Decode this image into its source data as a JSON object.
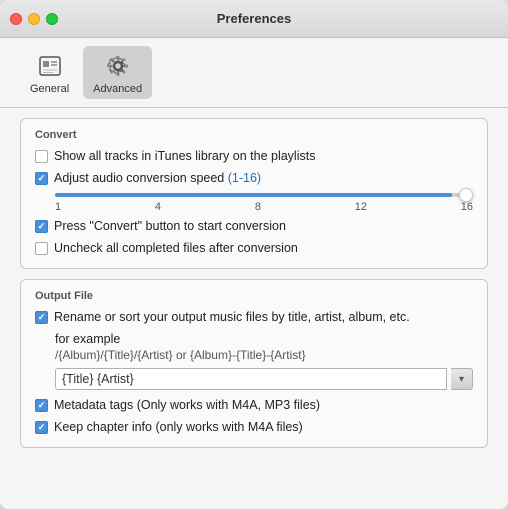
{
  "window": {
    "title": "Preferences"
  },
  "toolbar": {
    "items": [
      {
        "id": "general",
        "label": "General",
        "icon": "general",
        "active": false
      },
      {
        "id": "advanced",
        "label": "Advanced",
        "icon": "gear",
        "active": true
      }
    ]
  },
  "convert_section": {
    "title": "Convert",
    "checkboxes": [
      {
        "id": "show-all-tracks",
        "checked": false,
        "label": "Show all tracks in iTunes library on the playlists"
      },
      {
        "id": "adjust-audio",
        "checked": true,
        "label_prefix": "Adjust audio conversion speed ",
        "label_highlight": "(1-16)",
        "has_slider": true
      },
      {
        "id": "press-convert",
        "checked": true,
        "label": "Press \"Convert\" button to start conversion"
      },
      {
        "id": "uncheck-completed",
        "checked": false,
        "label": "Uncheck all completed files after conversion"
      }
    ],
    "slider": {
      "min_label": "1",
      "labels": [
        "1",
        "4",
        "8",
        "12",
        "16"
      ],
      "value": 95,
      "fill_percent": 95
    }
  },
  "output_section": {
    "title": "Output File",
    "rename_checkbox": {
      "checked": true,
      "label": "Rename or sort your output music files by title, artist, album, etc."
    },
    "for_example_label": "for example",
    "example_path": "/{Album}/{Title}/{Artist} or {Album}-{Title}-{Artist}",
    "input_value": "{Title} {Artist}",
    "input_placeholder": "{Title} {Artist}",
    "dropdown_icon": "▾",
    "metadata_checkbox": {
      "checked": true,
      "label": "Metadata tags (Only works with M4A, MP3 files)"
    },
    "chapter_checkbox": {
      "checked": true,
      "label": "Keep chapter info (only works with  M4A files)"
    }
  }
}
